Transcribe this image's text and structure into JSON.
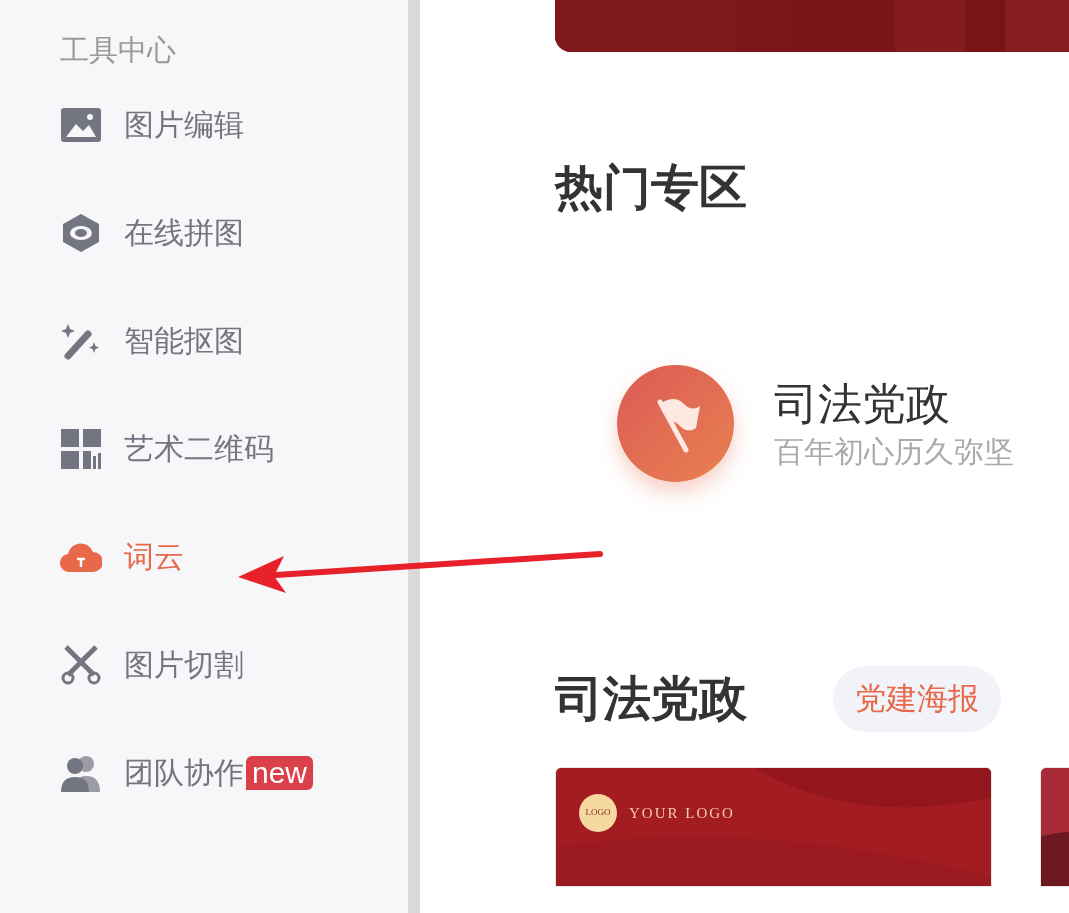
{
  "sidebar": {
    "title": "工具中心",
    "items": [
      {
        "label": "图片编辑",
        "selected": false
      },
      {
        "label": "在线拼图",
        "selected": false
      },
      {
        "label": "智能抠图",
        "selected": false
      },
      {
        "label": "艺术二维码",
        "selected": false
      },
      {
        "label": "词云",
        "selected": true
      },
      {
        "label": "图片切割",
        "selected": false
      },
      {
        "label": "团队协作",
        "selected": false,
        "badge": "new"
      }
    ]
  },
  "hot_zone": {
    "title": "热门专区",
    "feature": {
      "title": "司法党政",
      "subtitle": "百年初心历久弥坚"
    }
  },
  "section": {
    "title": "司法党政",
    "tag": "党建海报",
    "cards": [
      {
        "kind": "template",
        "logo_mark": "LOGO",
        "logo_text": "YOUR LOGO"
      },
      {
        "kind": "picture"
      }
    ]
  }
}
